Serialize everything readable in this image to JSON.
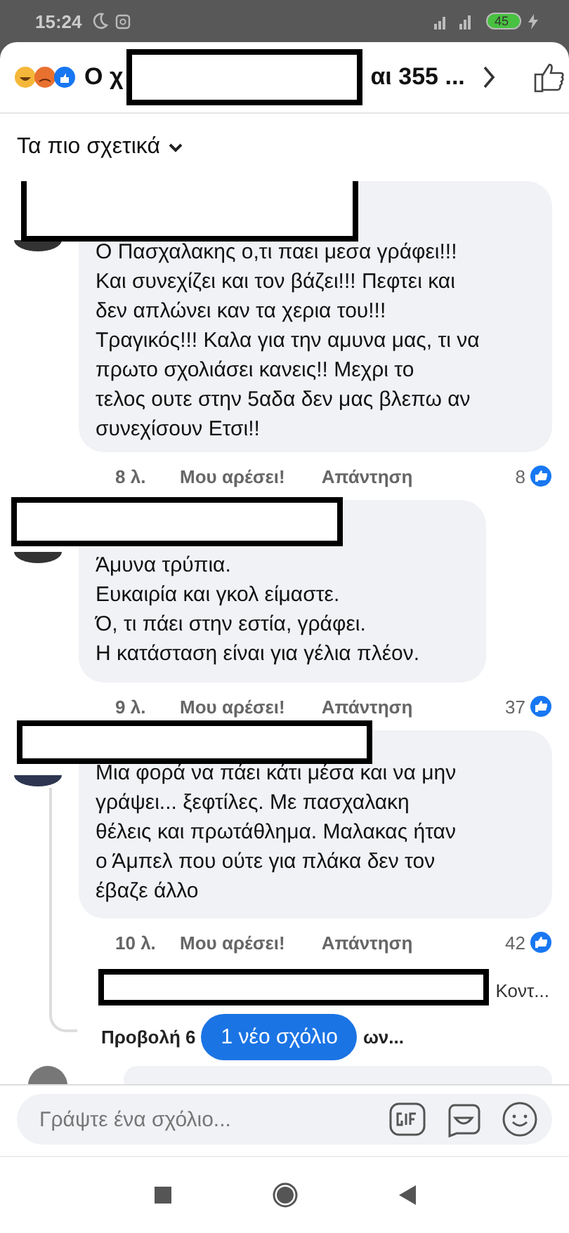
{
  "status_bar": {
    "time": "15:24",
    "battery": "45"
  },
  "header": {
    "title_start": "Ο χ",
    "title_end": "αι 355 ..."
  },
  "sort": {
    "label": "Τα πιο σχετικά"
  },
  "comments": [
    {
      "text": "Ο Πασχαλακης ο,τι παει μεσα γράφει!!!\nΚαι συνεχίζει και τον βάζει!!! Πεφτει και\nδεν απλώνει καν τα χερια του!!!\nΤραγικός!!! Καλα για την αμυνα μας, τι να\nπρωτο σχολιάσει κανεις!! Μεχρι το\nτελος ουτε στην 5αδα δεν μας βλεπω αν\nσυνεχίσουν Ετσι!!",
      "time": "8 λ.",
      "like": "Μου αρέσει!",
      "reply": "Απάντηση",
      "count": "8"
    },
    {
      "text": "Άμυνα τρύπια.\nΕυκαιρία και γκολ είμαστε.\nΌ, τι πάει στην εστία, γράφει.\nΗ κατάσταση είναι για γέλια πλέον.",
      "time": "9 λ.",
      "like": "Μου αρέσει!",
      "reply": "Απάντηση",
      "count": "37"
    },
    {
      "text": "Μια φορά να πάει κάτι μέσα και να μην\nγράψει... ξεφτίλες. Με πασχαλακη\nθέλεις και πρωτάθλημα. Μαλακας ήταν\nο Άμπελ που ούτε για πλάκα δεν τον\nέβαζε άλλο",
      "time": "10 λ.",
      "like": "Μου αρέσει!",
      "reply": "Απάντηση",
      "count": "42"
    }
  ],
  "reply_preview": {
    "text": "Κοντ..."
  },
  "view_more": {
    "start": "Προβολή 6",
    "end": "ων..."
  },
  "new_comments_pill": "1 νέο σχόλιο",
  "composer": {
    "placeholder": "Γράψτε ένα σχόλιο..."
  }
}
